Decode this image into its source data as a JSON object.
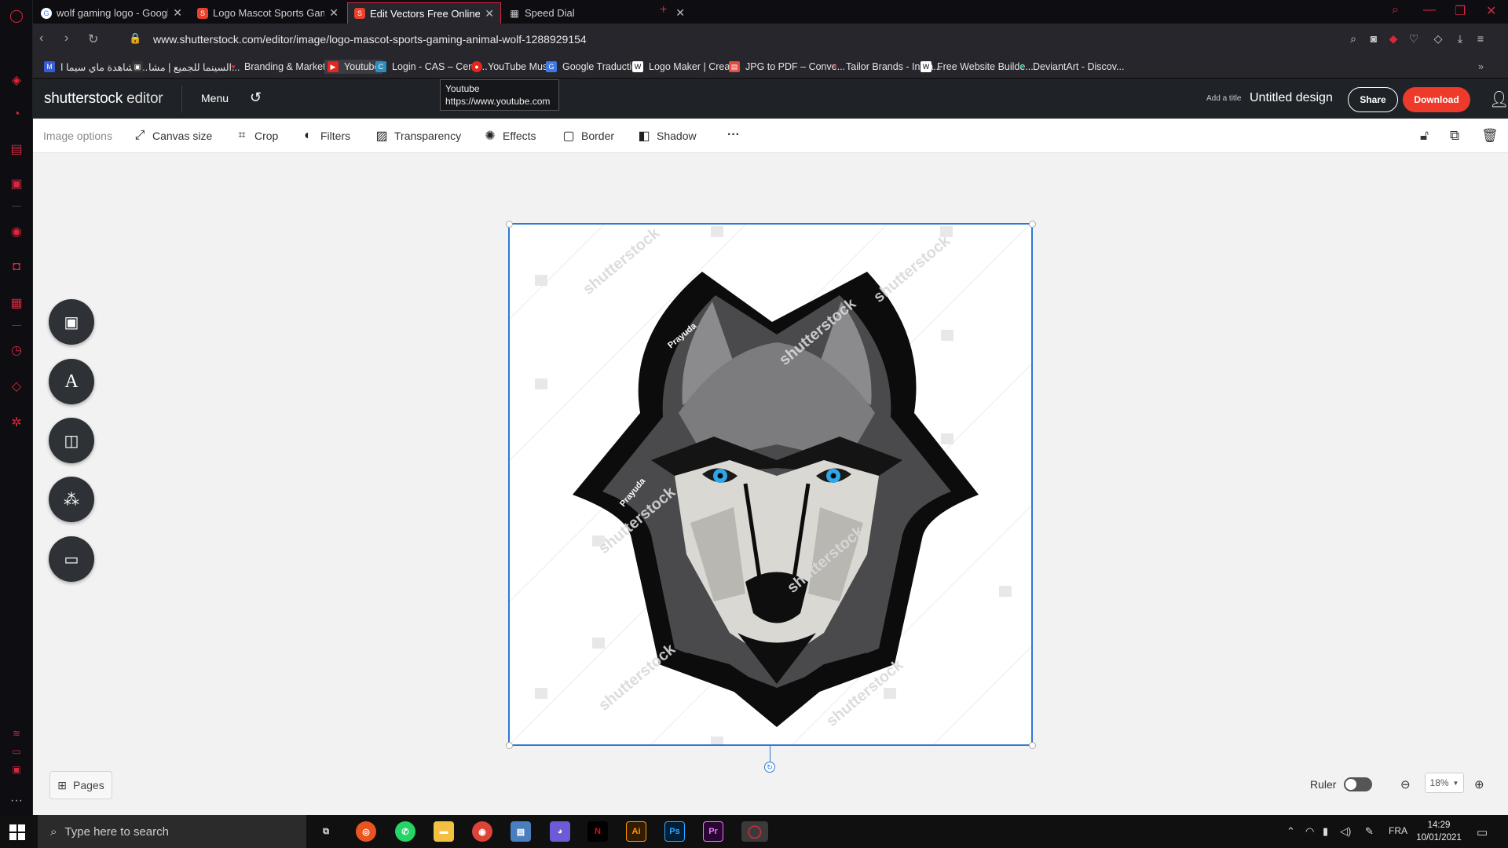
{
  "browser": {
    "tabs": [
      {
        "title": "wolf gaming logo - Google",
        "favicon": "google-icon",
        "color": "#ffffff"
      },
      {
        "title": "Logo Mascot Sports Gamin",
        "favicon": "shutterstock-icon",
        "color": "#e8412c"
      },
      {
        "title": "Edit Vectors Free Online - I",
        "favicon": "shutterstock-icon",
        "color": "#e8412c"
      },
      {
        "title": "Speed Dial",
        "favicon": "grid-icon",
        "color": "#cccccc"
      }
    ],
    "url": "www.shutterstock.com/editor/image/logo-mascot-sports-gaming-animal-wolf-1288929154",
    "bookmarks": [
      {
        "label": "مشاهدة ماي سيما ا...",
        "icon_color": "#3a5bd6",
        "icon": "M"
      },
      {
        "label": "السينما للجميع | مشا...",
        "icon_color": "#333333",
        "icon": "▣"
      },
      {
        "label": "Branding & Marketi...",
        "icon_color": "#d4283e",
        "icon": "♥"
      },
      {
        "label": "Youtube",
        "icon_color": "#e8251c",
        "icon": "▶"
      },
      {
        "label": "Login - CAS – Centr...",
        "icon_color": "#2a8fbf",
        "icon": "C"
      },
      {
        "label": "YouTube Music",
        "icon_color": "#e8251c",
        "icon": "●"
      },
      {
        "label": "Google Traduction",
        "icon_color": "#3d78e3",
        "icon": "G"
      },
      {
        "label": "Logo Maker | Creat...",
        "icon_color": "#ffffff",
        "icon": "W"
      },
      {
        "label": "JPG to PDF – Conve...",
        "icon_color": "#e34b3c",
        "icon": "▤"
      },
      {
        "label": "Tailor Brands - Insta...",
        "icon_color": "#d4283e",
        "icon": "♥"
      },
      {
        "label": "Free Website Builde...",
        "icon_color": "#ffffff",
        "icon": "W"
      },
      {
        "label": "DeviantArt - Discov...",
        "icon_color": "#06c26d",
        "icon": "✦"
      }
    ],
    "tooltip": {
      "line1": "Youtube",
      "line2": "https://www.youtube.com"
    }
  },
  "editor": {
    "logo_bold": "shutterstock",
    "logo_light": " editor",
    "menu_label": "Menu",
    "add_title_label": "Add a title",
    "design_title": "Untitled design",
    "share_label": "Share",
    "download_label": "Download",
    "accent": "#ee3a2a"
  },
  "toolbar": {
    "image_options": "Image options",
    "tools": [
      {
        "label": "Canvas size",
        "icon": "expand-icon"
      },
      {
        "label": "Crop",
        "icon": "crop-icon"
      },
      {
        "label": "Filters",
        "icon": "filters-icon"
      },
      {
        "label": "Transparency",
        "icon": "transparency-icon"
      },
      {
        "label": "Effects",
        "icon": "effects-icon"
      },
      {
        "label": "Border",
        "icon": "border-icon"
      },
      {
        "label": "Shadow",
        "icon": "shadow-icon"
      }
    ],
    "more": "···"
  },
  "canvas": {
    "left_panel": [
      "image-icon",
      "text-icon",
      "template-icon",
      "elements-icon",
      "folder-icon"
    ],
    "pages_label": "Pages",
    "ruler_label": "Ruler",
    "zoom": "18%",
    "watermark": "shutterstock",
    "credit": "Prayuda",
    "selection_color": "#2d79d6"
  },
  "taskbar": {
    "search_placeholder": "Type here to search",
    "language": "FRA",
    "time": "14:29",
    "date": "10/01/2021"
  }
}
